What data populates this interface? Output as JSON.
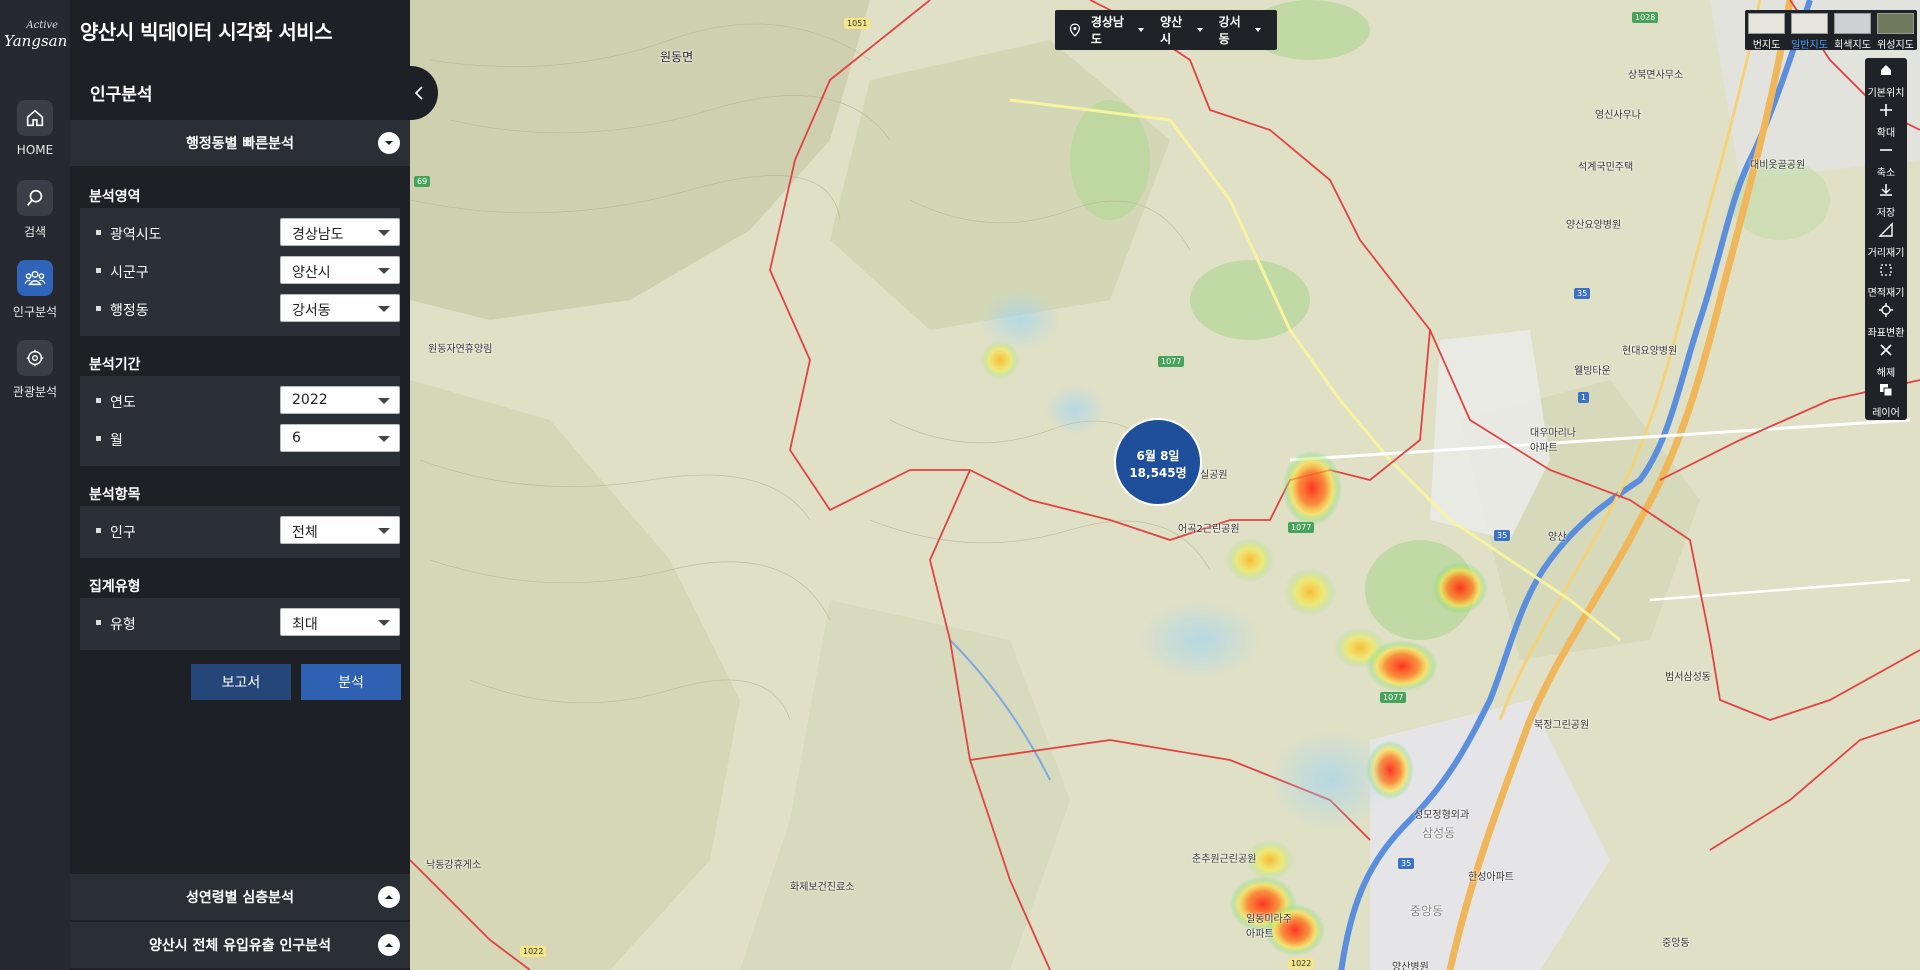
{
  "brand": {
    "logo_small": "Active",
    "logo_big": "Yangsan"
  },
  "app_title": "양산시 빅데이터 시각화 서비스",
  "rail": [
    {
      "label": "HOME",
      "icon": "home-icon"
    },
    {
      "label": "검색",
      "icon": "search-icon"
    },
    {
      "label": "인구분석",
      "icon": "people-icon",
      "active": true
    },
    {
      "label": "관광분석",
      "icon": "tourism-icon"
    }
  ],
  "panel": {
    "section_title": "인구분석",
    "quick_analysis": "행정동별 빠른분석",
    "groups": {
      "area": {
        "title": "분석영역",
        "rows": [
          {
            "label": "광역시도",
            "value": "경상남도"
          },
          {
            "label": "시군구",
            "value": "양산시"
          },
          {
            "label": "행정동",
            "value": "강서동"
          }
        ]
      },
      "period": {
        "title": "분석기간",
        "rows": [
          {
            "label": "연도",
            "value": "2022"
          },
          {
            "label": "월",
            "value": "6"
          }
        ]
      },
      "item": {
        "title": "분석항목",
        "rows": [
          {
            "label": "인구",
            "value": "전체"
          }
        ]
      },
      "agg": {
        "title": "집계유형",
        "rows": [
          {
            "label": "유형",
            "value": "최대"
          }
        ]
      }
    },
    "buttons": {
      "report": "보고서",
      "analyze": "분석"
    },
    "accordions": {
      "age_gender": "성연령별 심층분석",
      "inflow": "양산시 전체 유입유출 인구분석"
    }
  },
  "map": {
    "region_selector": {
      "province": "경상남도",
      "city": "양산시",
      "dong": "강서동"
    },
    "peak": {
      "line1": "6월 8일",
      "line2": "18,545명"
    },
    "map_types": [
      {
        "label": "번지도"
      },
      {
        "label": "일반지도",
        "selected": true
      },
      {
        "label": "회색지도"
      },
      {
        "label": "위성지도"
      }
    ],
    "tools": [
      {
        "label": "기본위치",
        "icon": "home-icon"
      },
      {
        "label": "확대",
        "icon": "zoom-in-icon"
      },
      {
        "label": "축소",
        "icon": "zoom-out-icon"
      },
      {
        "label": "저장",
        "icon": "download-icon"
      },
      {
        "label": "거리재기",
        "icon": "ruler-icon"
      },
      {
        "label": "면적재기",
        "icon": "area-icon"
      },
      {
        "label": "좌표변환",
        "icon": "coordinate-icon"
      },
      {
        "label": "해제",
        "icon": "clear-icon"
      },
      {
        "label": "레이어",
        "icon": "layers-icon"
      }
    ],
    "labels": {
      "wondong": "원동면",
      "wondongja": "원동자연휴양림",
      "eogok_park": "어곡2근린공원",
      "silgong": "실공원",
      "sangbuk_office": "상북면사무소",
      "yeongsin_temple": "영신사우나",
      "seokgye": "석계국민주택",
      "daebi": "대비옷골공원",
      "yangsan_hosp": "양산요양병원",
      "hyundai_hosp": "현대요양병원",
      "wellbing": "웰빙타운",
      "daewoo": "대우마리나\n아파트",
      "ic": "양산",
      "bukjeong_park": "북정그린공원",
      "beomseo": "범서삼성동",
      "seongmo": "성모정형외과",
      "samseong": "삼성동",
      "jungang": "중앙동",
      "hanseong": "한성아파트",
      "junghyun": "중앙동",
      "chunchu": "춘추원근린공원",
      "ildong": "일동미라주\n아파트",
      "hwajebo": "화제보건진료소",
      "nakdong": "낙동강휴게소",
      "yangsan_med": "양산병원"
    },
    "roads": [
      "1051",
      "1028",
      "69",
      "1077",
      "1077",
      "1077",
      "35",
      "35",
      "1",
      "1022",
      "1022",
      "35"
    ]
  }
}
